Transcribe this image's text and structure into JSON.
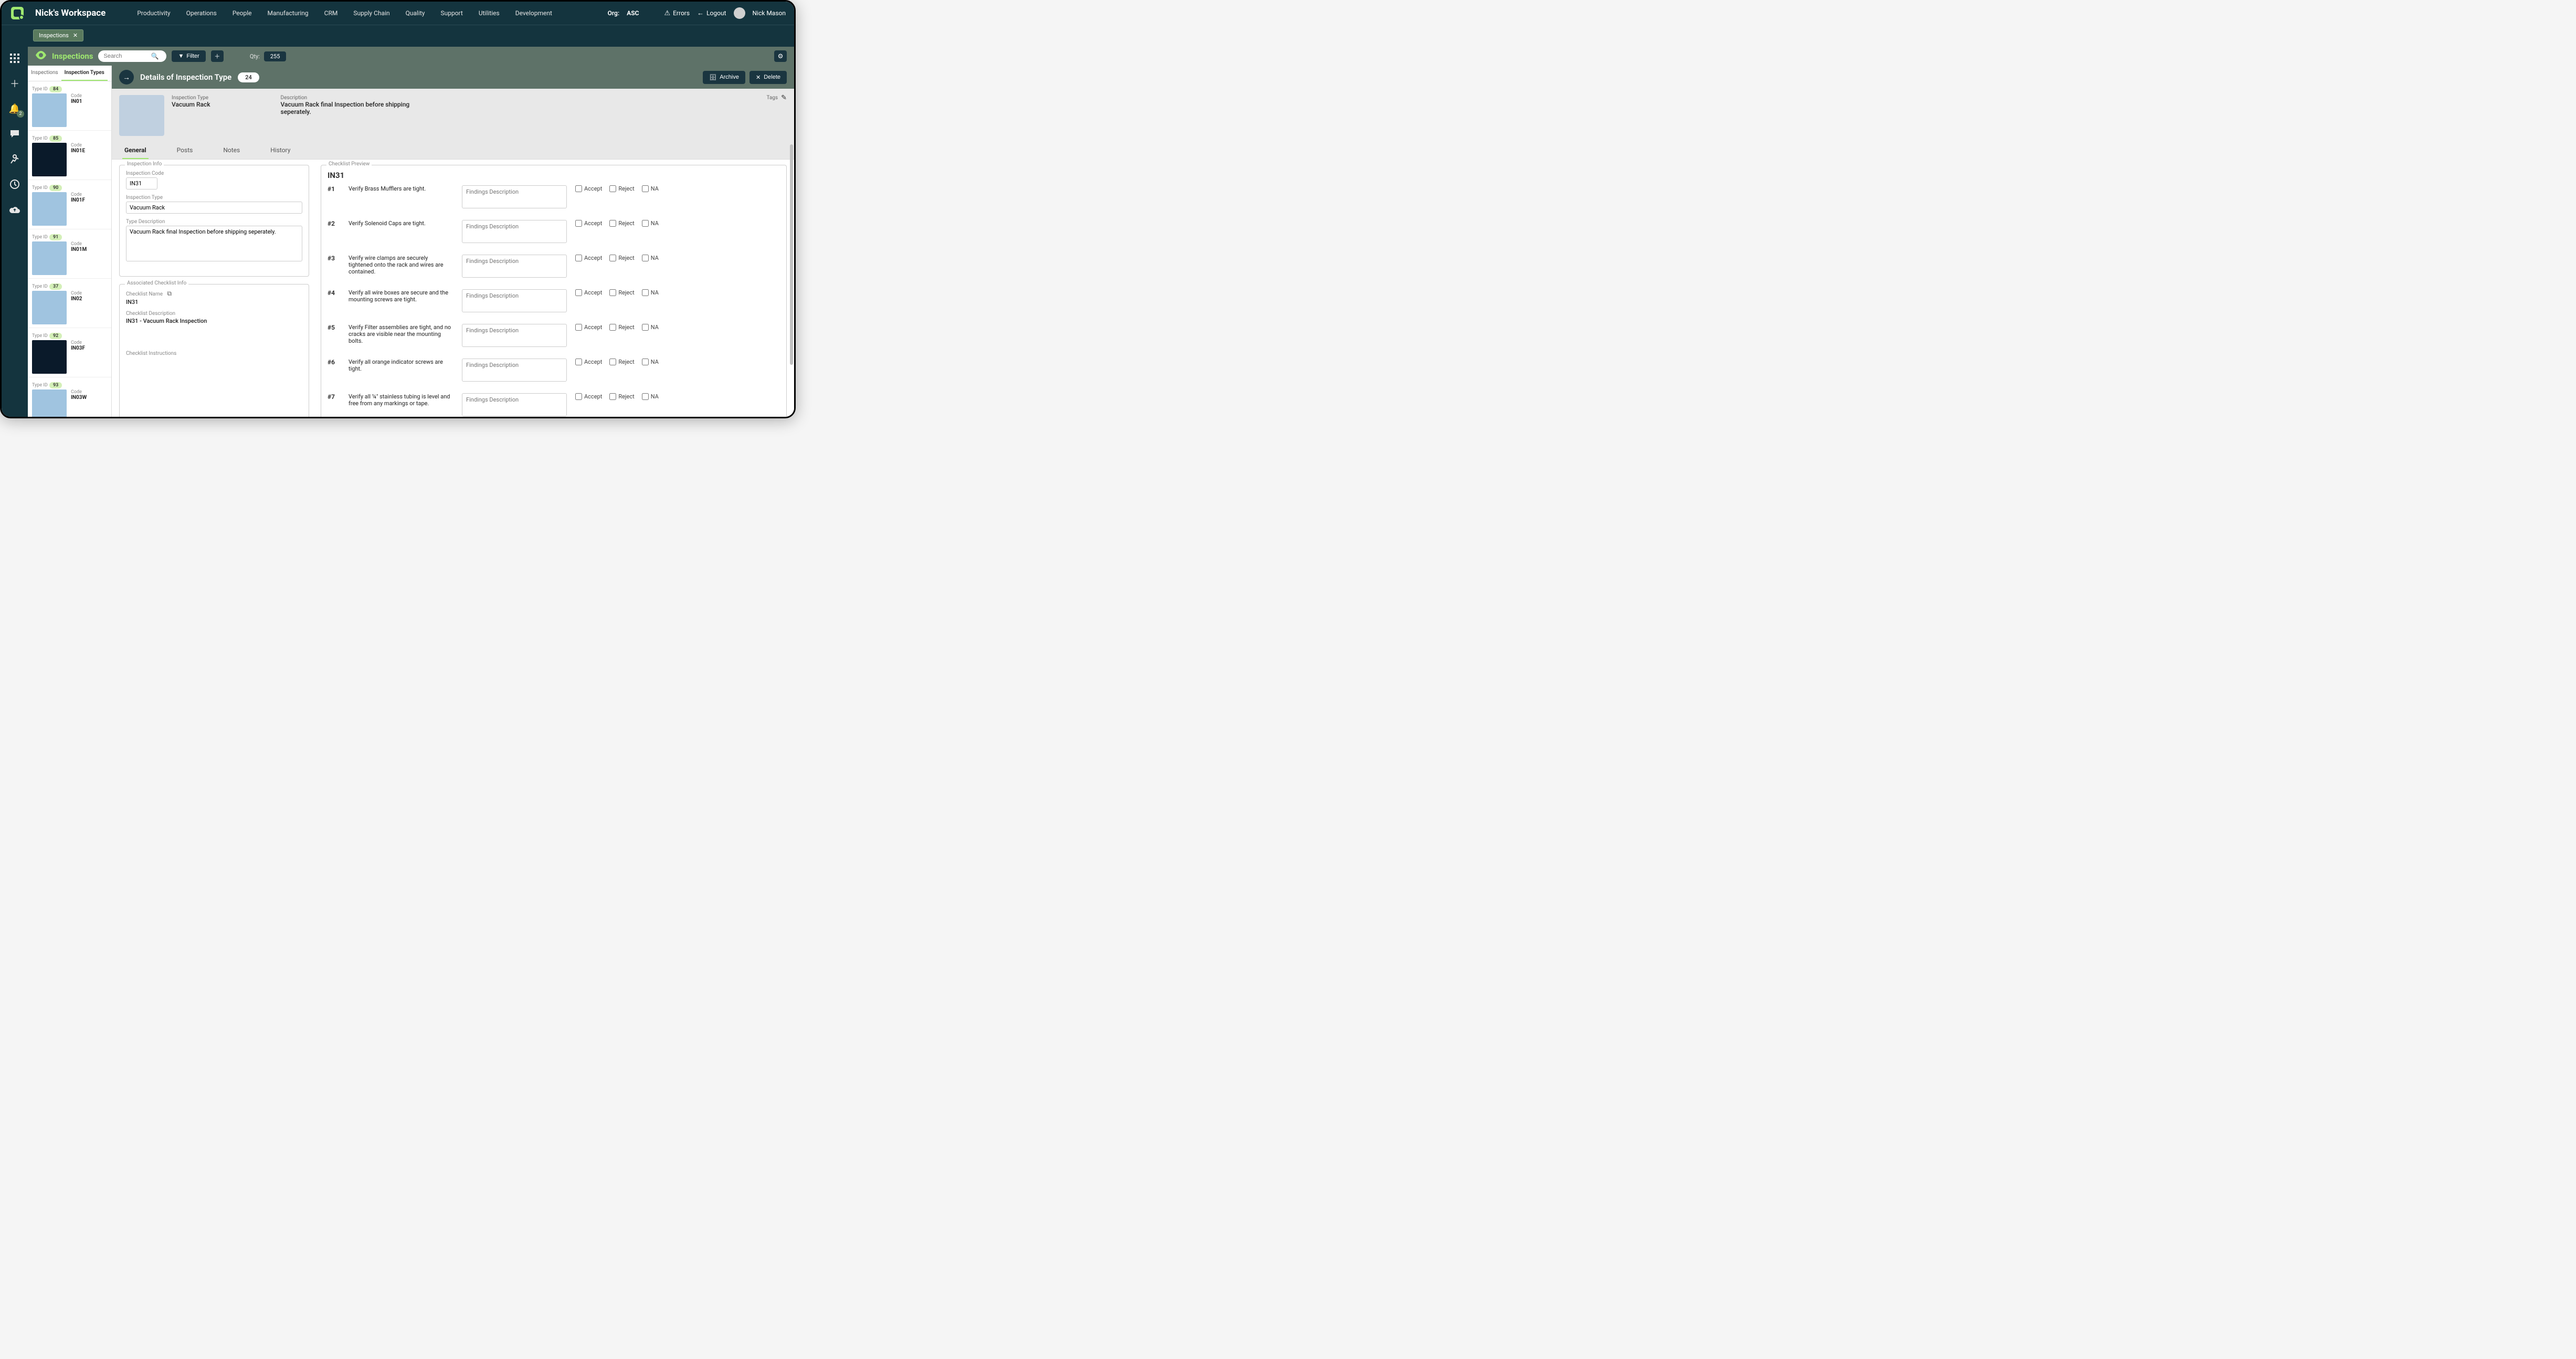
{
  "workspace_title": "Nick's Workspace",
  "nav": [
    "Productivity",
    "Operations",
    "People",
    "Manufacturing",
    "CRM",
    "Supply Chain",
    "Quality",
    "Support",
    "Utilities",
    "Development"
  ],
  "org_label": "Org:",
  "org_value": "ASC",
  "top_actions": {
    "errors": "Errors",
    "logout": "Logout"
  },
  "user_name": "Nick Mason",
  "open_tab": "Inspections",
  "rail_badge": "2",
  "toolbar": {
    "title": "Inspections",
    "search_placeholder": "Search",
    "filter": "Filter",
    "qty_label": "Qty:",
    "qty_value": "255"
  },
  "list_tabs": [
    "Inspections",
    "Inspection Types"
  ],
  "active_list_tab": 1,
  "types": [
    {
      "id": "84",
      "code": "IN01",
      "thumb": "blue"
    },
    {
      "id": "85",
      "code": "IN01E",
      "thumb": "dark"
    },
    {
      "id": "90",
      "code": "IN01F",
      "thumb": "blue"
    },
    {
      "id": "91",
      "code": "IN01M",
      "thumb": "blue"
    },
    {
      "id": "37",
      "code": "IN02",
      "thumb": "blue"
    },
    {
      "id": "92",
      "code": "IN03F",
      "thumb": "dark"
    },
    {
      "id": "93",
      "code": "IN03W",
      "thumb": "blue"
    }
  ],
  "type_id_label": "Type ID",
  "code_label": "Code",
  "detail": {
    "title": "Details of Inspection Type",
    "count": "24",
    "archive": "Archive",
    "delete": "Delete",
    "insp_type_label": "Inspection Type",
    "insp_type_value": "Vacuum Rack",
    "desc_label": "Description",
    "desc_value": "Vacuum Rack final Inspection before shipping seperately.",
    "tags_label": "Tags"
  },
  "subtabs": [
    "General",
    "Posts",
    "Notes",
    "History"
  ],
  "active_subtab": 0,
  "form": {
    "inspection_info": "Inspection Info",
    "inspection_code_label": "Inspection Code",
    "inspection_code": "IN31",
    "inspection_type_label": "Inspection Type",
    "inspection_type": "Vacuum Rack",
    "type_desc_label": "Type Description",
    "type_desc": "Vacuum Rack final Inspection before shipping seperately.",
    "assoc_checklist": "Associated Checklist Info",
    "checklist_name_label": "Checklist Name",
    "checklist_name": "IN31",
    "checklist_desc_label": "Checklist Description",
    "checklist_desc": "IN31 - Vacuum Rack Inspection",
    "checklist_instructions_label": "Checklist Instructions"
  },
  "preview": {
    "legend": "Checklist Preview",
    "code": "IN31",
    "findings_placeholder": "Findings Description",
    "accept": "Accept",
    "reject": "Reject",
    "na": "NA",
    "items": [
      {
        "n": "#1",
        "text": "Verify Brass Mufflers are tight."
      },
      {
        "n": "#2",
        "text": "Verify Solenoid Caps are tight."
      },
      {
        "n": "#3",
        "text": "Verify wire clamps are securely tightened onto the rack and wires are contained."
      },
      {
        "n": "#4",
        "text": "Verify all wire boxes are secure and the mounting screws are tight."
      },
      {
        "n": "#5",
        "text": "Verify Filter assemblies are tight, and no cracks are visible near the mounting bolts."
      },
      {
        "n": "#6",
        "text": "Verify all orange indicator screws are tight."
      },
      {
        "n": "#7",
        "text": "Verify all ¼\" stainless tubing is level and free from any markings or tape."
      }
    ]
  }
}
